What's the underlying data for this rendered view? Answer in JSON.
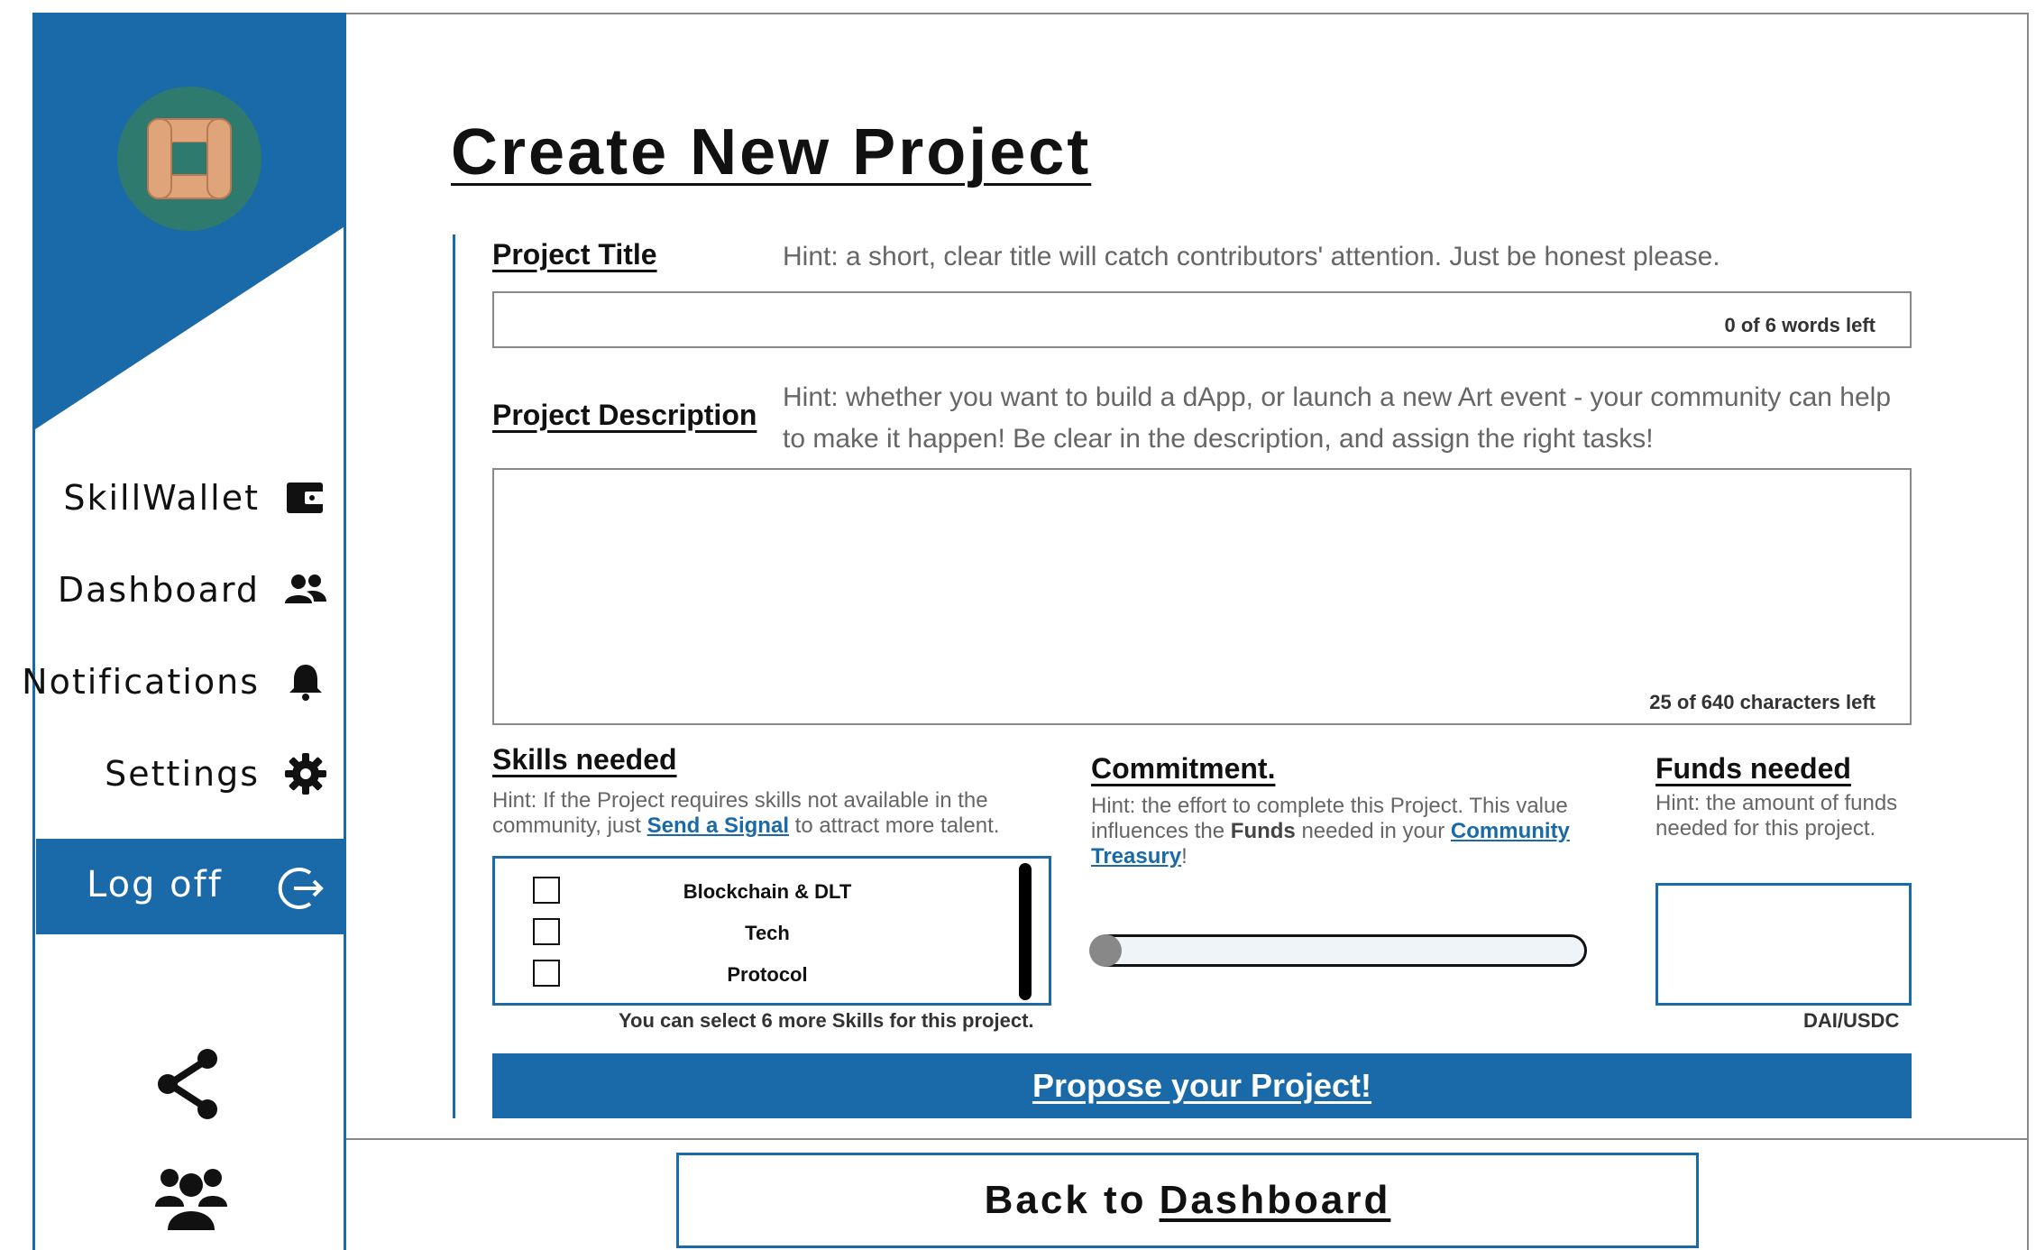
{
  "sidebar": {
    "nav": [
      {
        "label": "SkillWallet",
        "icon": "wallet-icon"
      },
      {
        "label": "Dashboard",
        "icon": "users-icon"
      },
      {
        "label": "Notifications",
        "icon": "bell-icon"
      },
      {
        "label": "Settings",
        "icon": "gear-icon"
      }
    ],
    "logoff": {
      "label": "Log off",
      "icon": "logout-icon"
    },
    "bottom_icons": [
      "share-icon",
      "group-icon"
    ]
  },
  "page": {
    "title": "Create New Project"
  },
  "form": {
    "title": {
      "label": "Project Title",
      "hint": "Hint: a short, clear title will catch contributors' attention. Just be honest please.",
      "value": "",
      "counter": "0 of 6 words left"
    },
    "description": {
      "label": "Project Description",
      "hint": "Hint: whether you want to build a dApp, or launch a new Art event - your community can help to make it happen! Be clear in the description, and assign the right tasks!",
      "value": "",
      "counter": "25 of 640 characters left"
    },
    "skills": {
      "label": "Skills needed",
      "hint_pre": "Hint: If the Project requires skills not available in the community, just ",
      "hint_link": "Send a Signal",
      "hint_post": " to attract more talent.",
      "options": [
        "Blockchain & DLT",
        "Tech",
        "Protocol"
      ],
      "note": "You can select 6 more Skills for this project."
    },
    "commitment": {
      "label": "Commitment.",
      "hint_pre": "Hint: the effort to complete this Project. This value influences the ",
      "hint_bold": "Funds",
      "hint_mid": " needed in your ",
      "hint_link": "Community Treasury",
      "hint_post": "!",
      "level": 0
    },
    "funds": {
      "label": "Funds needed",
      "hint": "Hint: the amount of funds needed for this project.",
      "currency": "DAI/USDC",
      "value": ""
    },
    "submit_label": "Propose your Project!"
  },
  "back": {
    "prefix": "Back to",
    "link": "Dashboard"
  },
  "colors": {
    "brand_blue": "#1a69a8",
    "logo_ring": "#2f7a6e",
    "logo_hands": "#e0a47a"
  }
}
